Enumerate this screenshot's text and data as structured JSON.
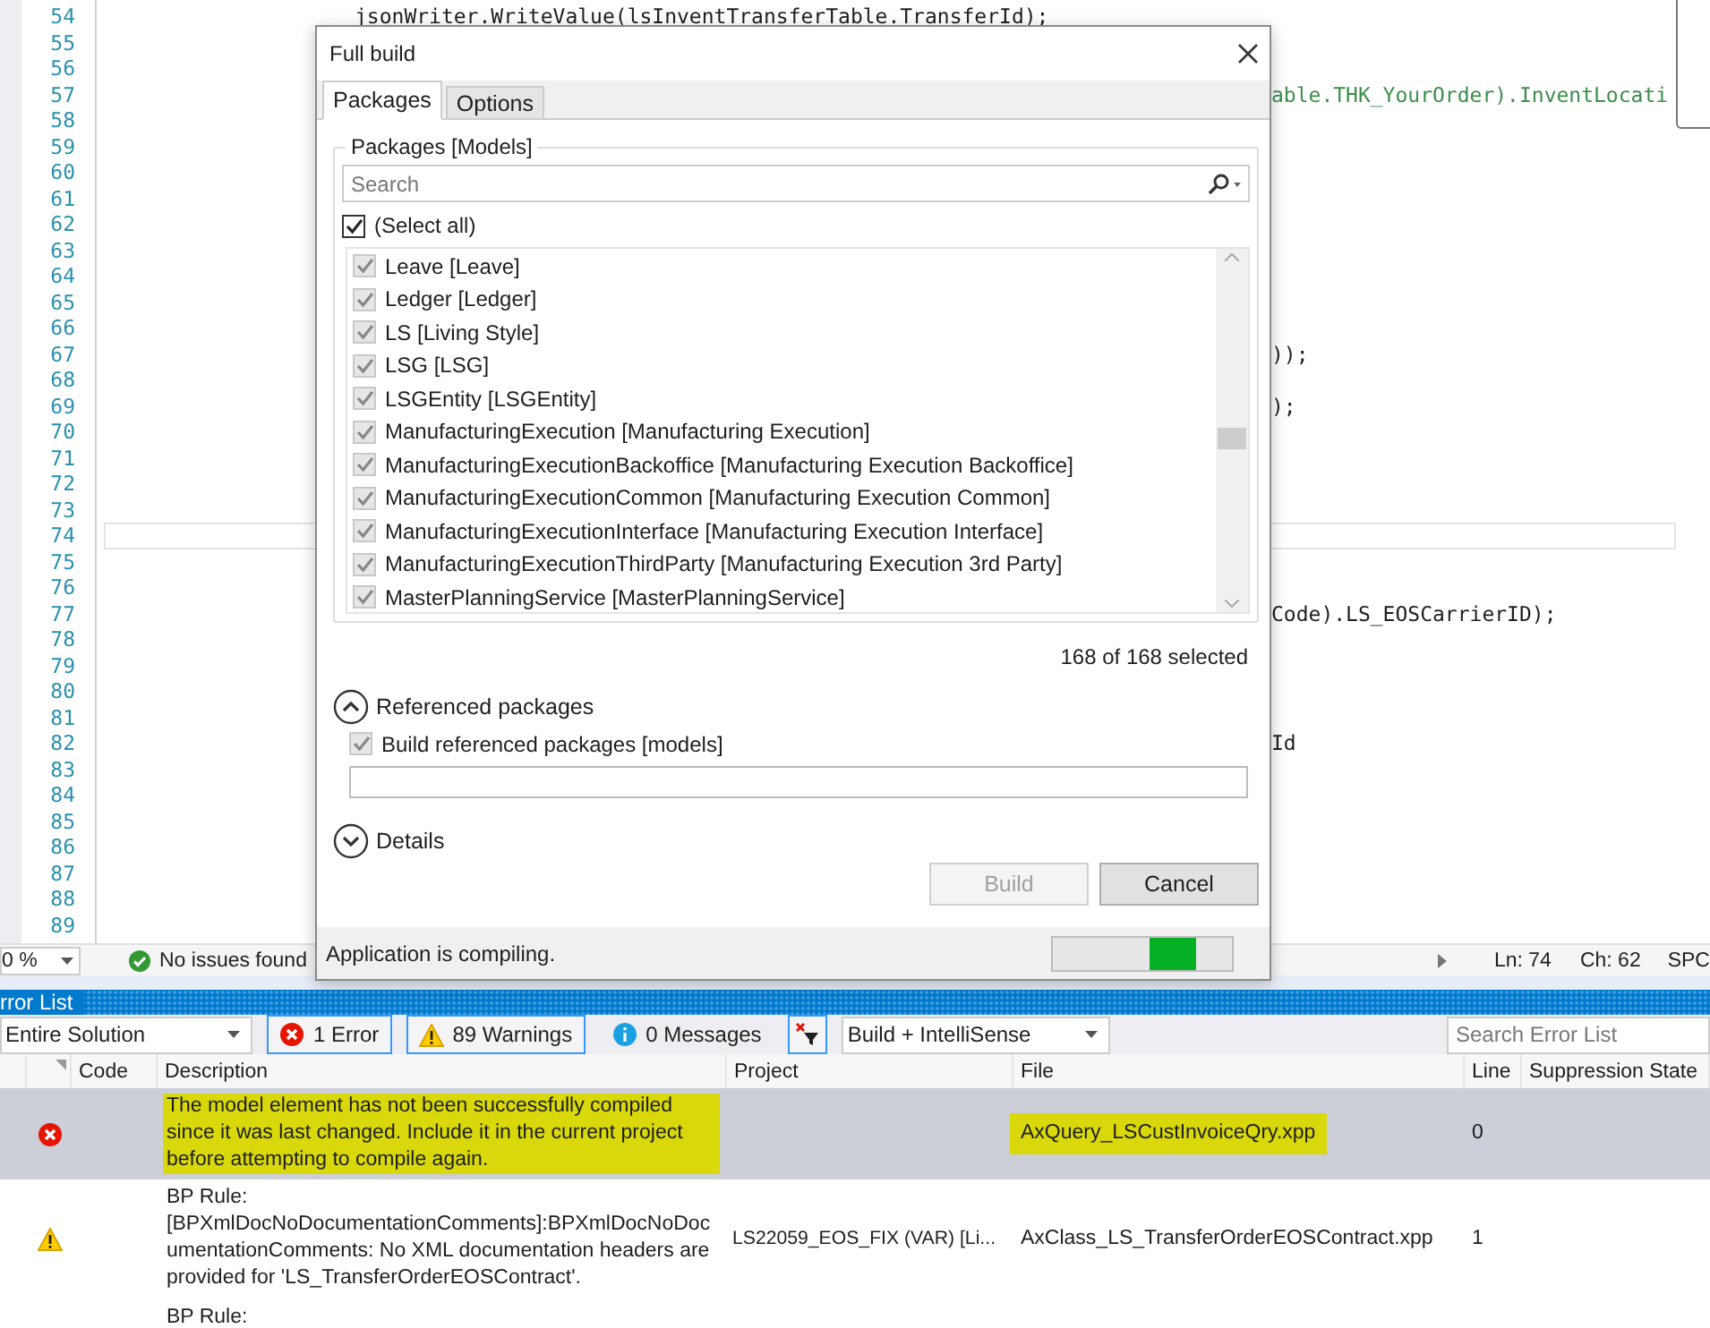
{
  "editor": {
    "lines": [
      {
        "number": "54",
        "current": false,
        "kind": "code",
        "text": "jsonWriter.WriteValue(lsInventTransferTable.TransferId);"
      },
      {
        "number": "55",
        "current": false
      },
      {
        "number": "56",
        "current": false
      },
      {
        "number": "57",
        "current": false,
        "kind": "comment-fragment",
        "text": "able.THK_YourOrder).InventLocati"
      },
      {
        "number": "58",
        "current": false
      },
      {
        "number": "59",
        "current": false
      },
      {
        "number": "60",
        "current": false
      },
      {
        "number": "61",
        "current": false
      },
      {
        "number": "62",
        "current": false
      },
      {
        "number": "63",
        "current": false
      },
      {
        "number": "64",
        "current": false
      },
      {
        "number": "65",
        "current": false
      },
      {
        "number": "66",
        "current": false
      },
      {
        "number": "67",
        "current": false,
        "kind": "fragment",
        "text": "));"
      },
      {
        "number": "68",
        "current": false
      },
      {
        "number": "69",
        "current": false,
        "kind": "fragment",
        "text": ");"
      },
      {
        "number": "70",
        "current": false
      },
      {
        "number": "71",
        "current": false
      },
      {
        "number": "72",
        "current": false
      },
      {
        "number": "73",
        "current": false
      },
      {
        "number": "74",
        "current": true
      },
      {
        "number": "75",
        "current": false
      },
      {
        "number": "76",
        "current": false
      },
      {
        "number": "77",
        "current": false,
        "kind": "fragment",
        "text": "Code).LS_EOSCarrierID);"
      },
      {
        "number": "78",
        "current": false
      },
      {
        "number": "79",
        "current": false
      },
      {
        "number": "80",
        "current": false
      },
      {
        "number": "81",
        "current": false
      },
      {
        "number": "82",
        "current": false,
        "kind": "fragment",
        "text": "Id"
      },
      {
        "number": "83",
        "current": false
      },
      {
        "number": "84",
        "current": false
      },
      {
        "number": "85",
        "current": false
      },
      {
        "number": "86",
        "current": false
      },
      {
        "number": "87",
        "current": false
      },
      {
        "number": "88",
        "current": false
      },
      {
        "number": "89",
        "current": false
      }
    ]
  },
  "status_bar": {
    "zoom": "0 %",
    "issues": "No issues found",
    "line": "Ln: 74",
    "column": "Ch: 62",
    "mode": "SPC"
  },
  "dialog": {
    "title": "Full build",
    "tabs": [
      {
        "label": "Packages",
        "selected": true
      },
      {
        "label": "Options",
        "selected": false
      }
    ],
    "group_title": "Packages [Models]",
    "search": {
      "placeholder": "Search"
    },
    "select_all": {
      "label": "(Select all)",
      "checked": true,
      "disabled": false
    },
    "packages": [
      {
        "label": "Leave [Leave]",
        "checked": true,
        "disabled": true
      },
      {
        "label": "Ledger [Ledger]",
        "checked": true,
        "disabled": true
      },
      {
        "label": "LS [Living Style]",
        "checked": true,
        "disabled": true
      },
      {
        "label": "LSG [LSG]",
        "checked": true,
        "disabled": true
      },
      {
        "label": "LSGEntity [LSGEntity]",
        "checked": true,
        "disabled": true
      },
      {
        "label": "ManufacturingExecution [Manufacturing Execution]",
        "checked": true,
        "disabled": true
      },
      {
        "label": "ManufacturingExecutionBackoffice [Manufacturing Execution Backoffice]",
        "checked": true,
        "disabled": true
      },
      {
        "label": "ManufacturingExecutionCommon [Manufacturing Execution Common]",
        "checked": true,
        "disabled": true
      },
      {
        "label": "ManufacturingExecutionInterface [Manufacturing Execution Interface]",
        "checked": true,
        "disabled": true
      },
      {
        "label": "ManufacturingExecutionThirdParty [Manufacturing Execution 3rd Party]",
        "checked": true,
        "disabled": true
      },
      {
        "label": "MasterPlanningService [MasterPlanningService]",
        "checked": true,
        "disabled": true
      }
    ],
    "selection_count": "168 of 168 selected",
    "referenced": {
      "label": "Referenced packages",
      "expanded": true
    },
    "build_referenced": {
      "label": "Build referenced packages [models]",
      "checked": true,
      "disabled": true
    },
    "details": {
      "label": "Details",
      "expanded": false
    },
    "buttons": [
      {
        "label": "Build",
        "disabled": true
      },
      {
        "label": "Cancel",
        "disabled": false
      }
    ],
    "status": "Application is compiling.",
    "progress": {
      "level": 0.8
    }
  },
  "error_list": {
    "title": "rror List",
    "scope": "Entire Solution",
    "filters": [
      {
        "kind": "error",
        "label": "1 Error",
        "selected": true
      },
      {
        "kind": "warning",
        "label": "89 Warnings",
        "selected": true
      },
      {
        "kind": "message",
        "label": "0 Messages",
        "selected": false
      }
    ],
    "source": "Build + IntelliSense",
    "search": {
      "placeholder": "Search Error List"
    },
    "columns": [
      "Code",
      "Description",
      "Project",
      "File",
      "Line",
      "Suppression State"
    ],
    "rows": [
      {
        "kind": "error",
        "selected": true,
        "description": {
          "text": "The model element has not been successfully compiled since it was last changed. Include it in the current project before attempting to compile again.",
          "highlighted": true
        },
        "file": {
          "text": "AxQuery_LSCustInvoiceQry.xpp",
          "highlighted": true
        },
        "line": "0"
      },
      {
        "kind": "warning",
        "selected": false,
        "description": {
          "text": "BP Rule: [BPXmlDocNoDocumentationComments]:BPXmlDocNoDocumentationComments: No XML documentation headers are provided for 'LS_TransferOrderEOSContract'.",
          "highlighted": false
        },
        "project": "LS22059_EOS_FIX (VAR) [Li...",
        "file": {
          "text": "AxClass_LS_TransferOrderEOSContract.xpp",
          "highlighted": false
        },
        "line": "1"
      },
      {
        "kind": "plain",
        "selected": false,
        "description": {
          "text": "BP Rule:",
          "highlighted": false
        }
      }
    ]
  }
}
